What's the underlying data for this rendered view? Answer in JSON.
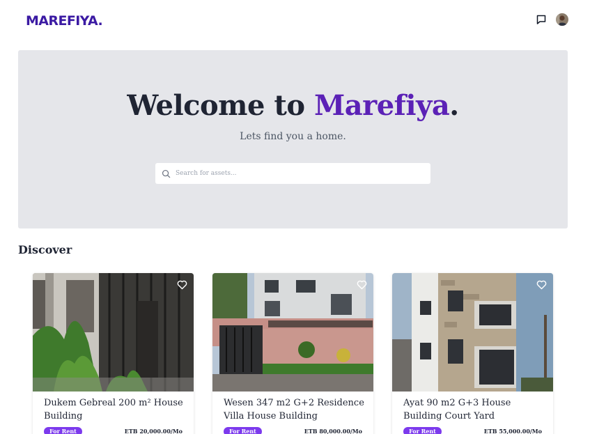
{
  "header": {
    "logo": "MAREFIYA.",
    "icons": [
      "message-icon",
      "user-avatar"
    ]
  },
  "hero": {
    "title_prefix": "Welcome to ",
    "title_brand": "Marefiya",
    "title_suffix": ".",
    "subtitle": "Lets find you a home.",
    "search_placeholder": "Search for assets..."
  },
  "discover": {
    "title": "Discover",
    "cards": [
      {
        "title": "Dukem Gebreal 200 m² House Building",
        "badge": "For Rent",
        "price": "ETB 20,000.00/Mo"
      },
      {
        "title": "Wesen 347 m2 G+2 Residence Villa House Building",
        "badge": "For Rent",
        "price": "ETB 80,000.00/Mo"
      },
      {
        "title": "Ayat 90 m2 G+3 House Building Court Yard",
        "badge": "For Rent",
        "price": "ETB 55,000.00/Mo"
      }
    ]
  },
  "colors": {
    "brand": "#5b21b6",
    "logo": "#3b1aa3",
    "badge": "#7c3aed",
    "hero_bg": "#e5e6ea"
  }
}
